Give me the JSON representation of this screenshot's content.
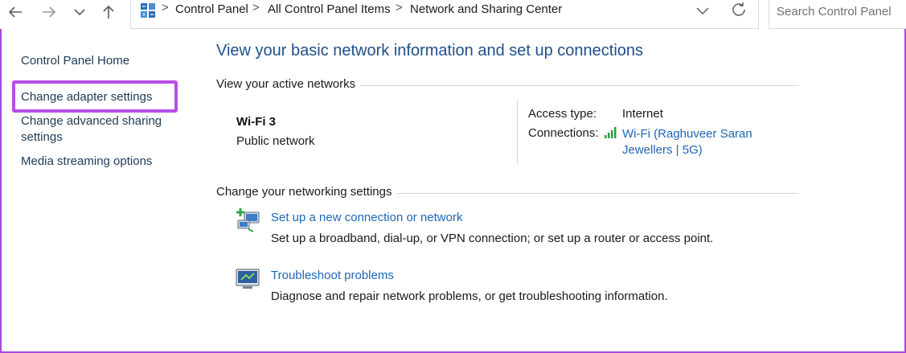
{
  "toolbar": {
    "breadcrumb": [
      "Control Panel",
      "All Control Panel Items",
      "Network and Sharing Center"
    ],
    "separator": ">",
    "search_placeholder": "Search Control Panel"
  },
  "sidebar": {
    "items": [
      {
        "label": "Control Panel Home"
      },
      {
        "label": "Change adapter settings"
      },
      {
        "label": "Change advanced sharing settings"
      },
      {
        "label": "Media streaming options"
      }
    ]
  },
  "main": {
    "title": "View your basic network information and set up connections",
    "active_networks_heading": "View your active networks",
    "network": {
      "name": "Wi-Fi 3",
      "category": "Public network",
      "access_type_label": "Access type:",
      "access_type_value": "Internet",
      "connections_label": "Connections:",
      "connection_link": "Wi-Fi (Raghuveer Saran Jewellers | 5G)"
    },
    "settings_heading": "Change your networking settings",
    "tasks": [
      {
        "link": "Set up a new connection or network",
        "description": "Set up a broadband, dial-up, or VPN connection; or set up a router or access point."
      },
      {
        "link": "Troubleshoot problems",
        "description": "Diagnose and repair network problems, or get troubleshooting information."
      }
    ]
  },
  "colors": {
    "highlight": "#b64ee6",
    "link": "#1f66b5",
    "title": "#1f4f8a"
  }
}
